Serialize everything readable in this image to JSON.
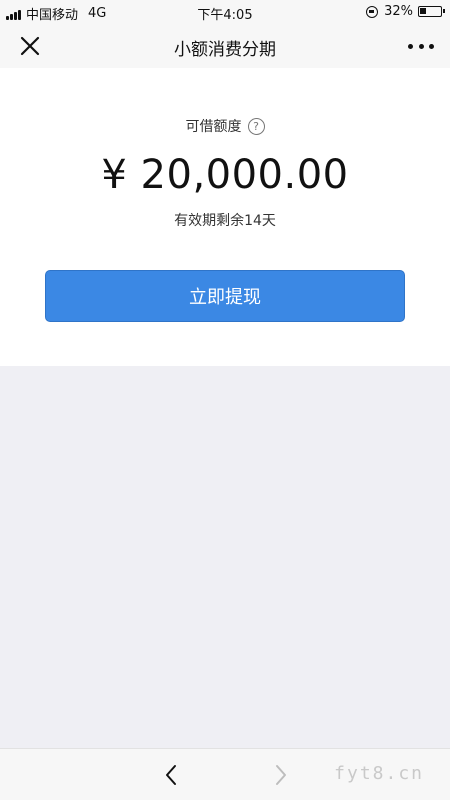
{
  "status_bar": {
    "carrier": "中国移动",
    "network": "4G",
    "time": "下午4:05",
    "battery": "32%",
    "battery_level": 0.32
  },
  "nav": {
    "title": "小额消费分期",
    "close_icon": "close-icon",
    "more_icon": "more-dots-icon"
  },
  "card": {
    "limit_label": "可借额度",
    "help_symbol": "?",
    "amount": "¥ 20,000.00",
    "validity": "有效期剩余14天",
    "button_label": "立即提现",
    "button_color": "#3b88e4"
  },
  "bottom_bar": {
    "back_icon": "chevron-left-icon",
    "forward_icon": "chevron-right-icon",
    "watermark": "fyt8.cn"
  },
  "colors": {
    "background": "#efeff4",
    "card": "#ffffff",
    "accent": "#3b88e4"
  }
}
